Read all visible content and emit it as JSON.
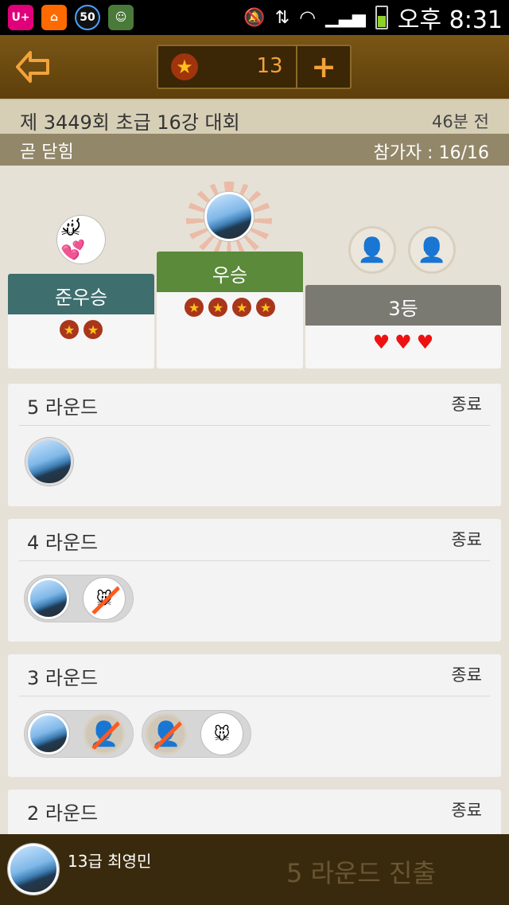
{
  "status_bar": {
    "time": "오후 8:31",
    "notif_badge": "50",
    "app_badge": "U+"
  },
  "top_bar": {
    "coin_count": "13",
    "plus_label": "+"
  },
  "tournament": {
    "title": "제 3449회 초급 16강 대회",
    "time_ago": "46분 전",
    "status": "곧 닫힘",
    "participants": "참가자 : 16/16"
  },
  "podium": {
    "second": {
      "label": "준우승",
      "stars": 2
    },
    "first": {
      "label": "우승",
      "stars": 4
    },
    "third": {
      "label": "3등",
      "hearts": 3
    }
  },
  "rounds": [
    {
      "title": "5 라운드",
      "status": "종료"
    },
    {
      "title": "4 라운드",
      "status": "종료"
    },
    {
      "title": "3 라운드",
      "status": "종료"
    },
    {
      "title": "2 라운드",
      "status": "종료"
    }
  ],
  "bottom_bar": {
    "player_name": "13급 최영민",
    "status": "5 라운드 진출"
  },
  "colors": {
    "winner": "#5a8a3a",
    "runner_up": "#3e6e6e",
    "third": "#7a7a72",
    "top_bar": "#6b4a10"
  }
}
